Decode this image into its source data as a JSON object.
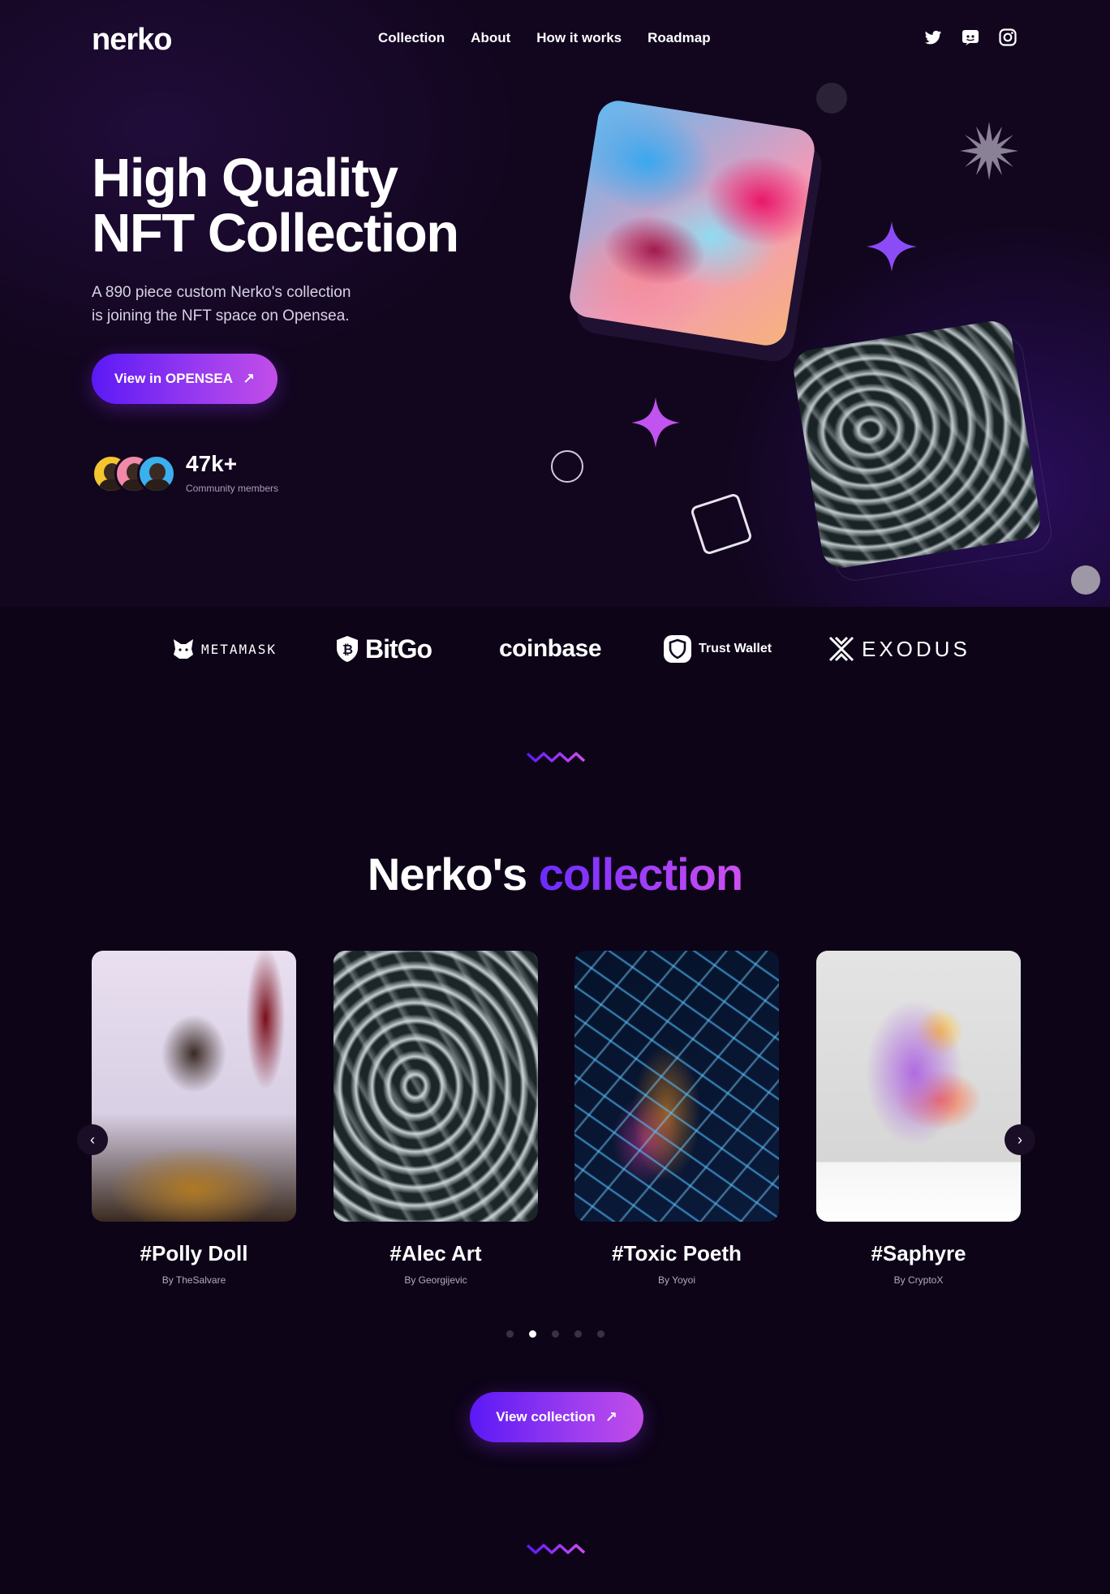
{
  "brand": {
    "logo": "nerko"
  },
  "nav": {
    "items": [
      "Collection",
      "About",
      "How it works",
      "Roadmap"
    ]
  },
  "socials": [
    "twitter-icon",
    "discord-icon",
    "instagram-icon"
  ],
  "hero": {
    "title_line1": "High Quality",
    "title_line2": "NFT Collection",
    "subtitle_line1": "A 890 piece custom Nerko's collection",
    "subtitle_line2": "is joining the NFT space on Opensea.",
    "cta_label": "View in OPENSEA",
    "community_count": "47k+",
    "community_label": "Community members"
  },
  "wallets": [
    "METAMASK",
    "BitGo",
    "coinbase",
    "Trust Wallet",
    "EXODUS"
  ],
  "collection": {
    "title": "Nerko's",
    "title_accent": "collection",
    "items": [
      {
        "name": "#Polly Doll",
        "author": "By TheSalvare"
      },
      {
        "name": "#Alec Art",
        "author": "By Georgijevic"
      },
      {
        "name": "#Toxic Poeth",
        "author": "By Yoyoi"
      },
      {
        "name": "#Saphyre",
        "author": "By CryptoX"
      }
    ],
    "active_page": 2,
    "page_count": 5,
    "cta_label": "View collection"
  },
  "colors": {
    "background": "#0d0418",
    "accent_start": "#5b19f5",
    "accent_end": "#c24ee8",
    "accent_text": "#a23cf4"
  }
}
